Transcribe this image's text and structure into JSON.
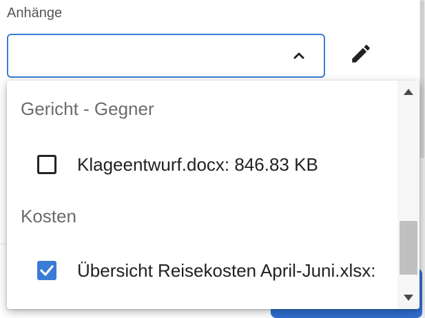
{
  "field": {
    "label": "Anhänge",
    "value": ""
  },
  "icons": {
    "dropdown_toggle": "chevron-up-icon",
    "edit": "pencil-icon"
  },
  "colors": {
    "accent": "#3a7bd5",
    "text": "#222222",
    "muted": "#6b6b6b"
  },
  "dropdown": {
    "groups": [
      {
        "header": "Gericht - Gegner",
        "options": [
          {
            "label": "Klageentwurf.docx: 846.83 KB",
            "checked": false
          }
        ]
      },
      {
        "header": "Kosten",
        "options": [
          {
            "label": "Übersicht Reisekosten April-Juni.xlsx:",
            "checked": true
          }
        ]
      }
    ]
  }
}
